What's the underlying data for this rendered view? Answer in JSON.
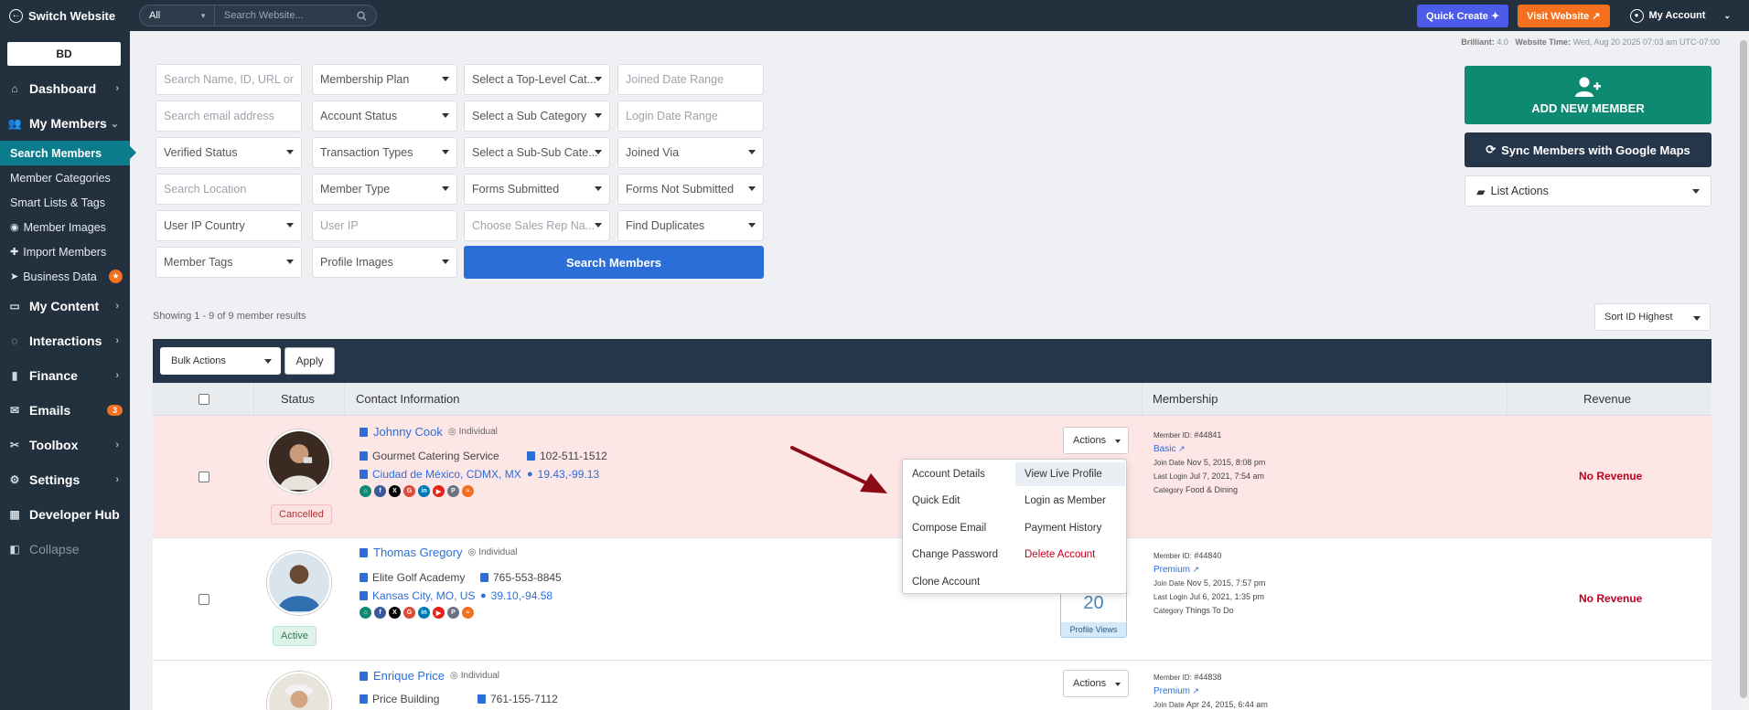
{
  "topbar": {
    "switch_label": "Switch Website",
    "search_scope": "All",
    "search_placeholder": "Search Website...",
    "quick_create": "Quick Create",
    "visit_website": "Visit Website",
    "my_account": "My Account"
  },
  "logo_text": "BD",
  "sidebar": {
    "items": [
      {
        "label": "Dashboard",
        "icon": "home-icon"
      },
      {
        "label": "My Members",
        "icon": "users-icon"
      },
      {
        "label": "My Content",
        "icon": "content-icon"
      },
      {
        "label": "Interactions",
        "icon": "chat-icon"
      },
      {
        "label": "Finance",
        "icon": "chart-icon"
      },
      {
        "label": "Emails",
        "icon": "mail-icon",
        "badge": "3"
      },
      {
        "label": "Toolbox",
        "icon": "wrench-icon"
      },
      {
        "label": "Settings",
        "icon": "gear-icon"
      },
      {
        "label": "Developer Hub",
        "icon": "grid-icon"
      },
      {
        "label": "Collapse",
        "icon": "collapse-icon"
      }
    ],
    "sub": [
      {
        "label": "Search Members"
      },
      {
        "label": "Member Categories"
      },
      {
        "label": "Smart Lists & Tags"
      },
      {
        "label": "Member Images"
      },
      {
        "label": "Import Members"
      },
      {
        "label": "Business Data"
      }
    ]
  },
  "brilliant": {
    "label": "Brilliant:",
    "version": "4.0",
    "time_label": "Website Time:",
    "time": "Wed, Aug 20 2025 07:03 am UTC-07:00"
  },
  "filters": {
    "search_name": "Search Name, ID, URL or",
    "membership_plan": "Membership Plan",
    "top_category": "Select a Top-Level Cat...",
    "joined_date": "Joined Date Range",
    "search_email": "Search email address",
    "account_status": "Account Status",
    "sub_category": "Select a Sub Category",
    "login_date": "Login Date Range",
    "verified_status": "Verified Status",
    "transaction_types": "Transaction Types",
    "subsub_category": "Select a Sub-Sub Cate...",
    "joined_via": "Joined Via",
    "search_location": "Search Location",
    "member_type": "Member Type",
    "forms_submitted": "Forms Submitted",
    "forms_not_submitted": "Forms Not Submitted",
    "user_ip_country": "User IP Country",
    "user_ip": "User IP",
    "sales_rep": "Choose Sales Rep Na...",
    "find_duplicates": "Find Duplicates",
    "member_tags": "Member Tags",
    "profile_images": "Profile Images",
    "search_button": "Search Members"
  },
  "right_panel": {
    "add_member": "ADD NEW MEMBER",
    "sync": "Sync Members with Google Maps",
    "list_actions": "List Actions"
  },
  "results": {
    "showing": "Showing 1 - 9 of 9 member results",
    "sort": "Sort ID Highest",
    "bulk_actions": "Bulk Actions",
    "apply": "Apply"
  },
  "table": {
    "headers": {
      "status": "Status",
      "contact": "Contact Information",
      "membership": "Membership",
      "revenue": "Revenue"
    },
    "rows": [
      {
        "name": "Johnny Cook",
        "type": "Individual",
        "company": "Gourmet Catering Service",
        "phone": "102-511-1512",
        "location": "Ciudad de México, CDMX, MX",
        "coords": "19.43,-99.13",
        "status": "Cancelled",
        "member_id": "#44841",
        "plan": "Basic",
        "join_date": "Nov 5, 2015, 8:08 pm",
        "last_login": "Jul 7, 2021, 7:54 am",
        "category": "Food & Dining",
        "revenue": "No Revenue",
        "actions": "Actions"
      },
      {
        "name": "Thomas Gregory",
        "type": "Individual",
        "company": "Elite Golf Academy",
        "phone": "765-553-8845",
        "location": "Kansas City, MO, US",
        "coords": "39.10,-94.58",
        "status": "Active",
        "member_id": "#44840",
        "plan": "Premium",
        "join_date": "Nov 5, 2015, 7:57 pm",
        "last_login": "Jul 6, 2021, 1:35 pm",
        "category": "Things To Do",
        "revenue": "No Revenue",
        "views": "20",
        "views_label": "Profile Views"
      },
      {
        "name": "Enrique Price",
        "type": "Individual",
        "company": "Price Building",
        "phone": "761-155-7112",
        "member_id": "#44838",
        "plan": "Premium",
        "join_date": "Apr 24, 2015, 6:44 am",
        "actions": "Actions"
      }
    ],
    "labels": {
      "member_id": "Member ID:",
      "join_date": "Join Date",
      "last_login": "Last Login",
      "category": "Category"
    }
  },
  "actions_menu": {
    "left": [
      "Account Details",
      "Quick Edit",
      "Compose Email",
      "Change Password",
      "Clone Account"
    ],
    "right": [
      "View Live Profile",
      "Login as Member",
      "Payment History",
      "Delete Account"
    ]
  },
  "colors": {
    "sidebar": "#23303e",
    "accent": "#2b6ed8",
    "add": "#0f8a72",
    "quick_create": "#4d5bea",
    "visit": "#f4701e",
    "danger": "#c0001e"
  }
}
